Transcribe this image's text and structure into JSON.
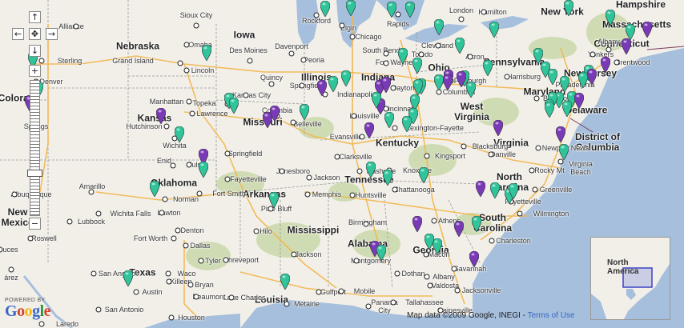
{
  "controls": {
    "pan_up": "↑",
    "pan_left": "←",
    "pan_center": "✥",
    "pan_right": "→",
    "pan_down": "↓",
    "zoom_in": "+",
    "zoom_out": "−"
  },
  "state_labels": [
    {
      "id": "nebraska",
      "text": "Nebraska"
    },
    {
      "id": "iowa",
      "text": "Iowa"
    },
    {
      "id": "illinois",
      "text": "Illinois"
    },
    {
      "id": "indiana",
      "text": "Indiana"
    },
    {
      "id": "ohio",
      "text": "Ohio"
    },
    {
      "id": "pennsylvania",
      "text": "Pennsylvania"
    },
    {
      "id": "new-york",
      "text": "New York"
    },
    {
      "id": "massachusetts",
      "text": "Massachusetts"
    },
    {
      "id": "connecticut",
      "text": "Connecticut"
    },
    {
      "id": "new-jersey",
      "text": "New Jersey"
    },
    {
      "id": "maryland",
      "text": "Maryland"
    },
    {
      "id": "delaware",
      "text": "Delaware"
    },
    {
      "id": "district-of-columbia",
      "text": "District of\nColumbia"
    },
    {
      "id": "colorado",
      "text": "Colorado"
    },
    {
      "id": "kansas",
      "text": "Kansas"
    },
    {
      "id": "missouri",
      "text": "Missouri"
    },
    {
      "id": "kentucky",
      "text": "Kentucky"
    },
    {
      "id": "west-virginia",
      "text": "West\nVirginia"
    },
    {
      "id": "virginia",
      "text": "Virginia"
    },
    {
      "id": "oklahoma",
      "text": "Oklahoma"
    },
    {
      "id": "arkansas",
      "text": "Arkansas"
    },
    {
      "id": "tennessee",
      "text": "Tennessee"
    },
    {
      "id": "north-carolina",
      "text": "North\nCarolina"
    },
    {
      "id": "south-carolina",
      "text": "South\nCarolina"
    },
    {
      "id": "new-mexico",
      "text": "New\nMexico"
    },
    {
      "id": "texas",
      "text": "Texas"
    },
    {
      "id": "mississippi",
      "text": "Mississippi"
    },
    {
      "id": "alabama",
      "text": "Alabama"
    },
    {
      "id": "georgia",
      "text": "Georgia"
    },
    {
      "id": "louisiana",
      "text": "Louisia"
    },
    {
      "id": "hampshire",
      "text": "Hampshire"
    }
  ],
  "city_labels": [
    {
      "id": "sioux-city",
      "text": "Sioux City"
    },
    {
      "id": "rockford",
      "text": "Rockford"
    },
    {
      "id": "grand-rapids",
      "text": "Rapids"
    },
    {
      "id": "london",
      "text": "London"
    },
    {
      "id": "hamilton",
      "text": "Hamilton"
    },
    {
      "id": "alliance",
      "text": "Alliance"
    },
    {
      "id": "omaha",
      "text": "Omaha"
    },
    {
      "id": "elgin",
      "text": "Elgin"
    },
    {
      "id": "chicago",
      "text": "Chicago"
    },
    {
      "id": "cleveland",
      "text": "Cleveland"
    },
    {
      "id": "albany",
      "text": "Albany"
    },
    {
      "id": "sterling",
      "text": "Sterling"
    },
    {
      "id": "grand-island",
      "text": "Grand Island"
    },
    {
      "id": "des-moines",
      "text": "Des Moines"
    },
    {
      "id": "davenport",
      "text": "Davenport"
    },
    {
      "id": "south-bend",
      "text": "South Bend"
    },
    {
      "id": "toledo",
      "text": "Toledo"
    },
    {
      "id": "akron",
      "text": "Akron"
    },
    {
      "id": "yonkers",
      "text": "Yonkers"
    },
    {
      "id": "brentwood",
      "text": "Brentwood"
    },
    {
      "id": "denver",
      "text": "Denver"
    },
    {
      "id": "lincoln",
      "text": "Lincoln"
    },
    {
      "id": "peoria",
      "text": "Peoria"
    },
    {
      "id": "fort-wayne",
      "text": "Fort Wayne"
    },
    {
      "id": "harrisburg",
      "text": "Harrisburg"
    },
    {
      "id": "quincy",
      "text": "Quincy"
    },
    {
      "id": "pittsburgh",
      "text": "Pittsburgh"
    },
    {
      "id": "dayton",
      "text": "Dayton"
    },
    {
      "id": "springfield-il",
      "text": "Springfield"
    },
    {
      "id": "columbus",
      "text": "Columbus"
    },
    {
      "id": "indianapolis",
      "text": "Indianapolis"
    },
    {
      "id": "philadelphia",
      "text": "Philadelphia"
    },
    {
      "id": "manhattan",
      "text": "Manhattan"
    },
    {
      "id": "kansas-city",
      "text": "Kansas City"
    },
    {
      "id": "topeka",
      "text": "Topeka"
    },
    {
      "id": "lawrence",
      "text": "Lawrence"
    },
    {
      "id": "baltimore",
      "text": "Baltimore"
    },
    {
      "id": "cincinnati",
      "text": "Cincinnati"
    },
    {
      "id": "colorado-springs",
      "text": "Springs"
    },
    {
      "id": "columbia-mo",
      "text": "Columbia"
    },
    {
      "id": "louisville",
      "text": "Louisville"
    },
    {
      "id": "belleville",
      "text": "Belleville"
    },
    {
      "id": "hutchinson",
      "text": "Hutchinson"
    },
    {
      "id": "lexington",
      "text": "Lexington-Fayette"
    },
    {
      "id": "evansville",
      "text": "Evansville"
    },
    {
      "id": "wichita",
      "text": "Wichita"
    },
    {
      "id": "springfield-mo",
      "text": "Springfield"
    },
    {
      "id": "danville",
      "text": "Danville"
    },
    {
      "id": "newport-news",
      "text": "Newport News"
    },
    {
      "id": "kingsport",
      "text": "Kingsport"
    },
    {
      "id": "blacksburg",
      "text": "Blacksburg"
    },
    {
      "id": "clarksville",
      "text": "Clarksville"
    },
    {
      "id": "enid",
      "text": "Enid"
    },
    {
      "id": "tulsa",
      "text": "Tulsa"
    },
    {
      "id": "fayetteville-ar",
      "text": "Fayetteville"
    },
    {
      "id": "jonesboro",
      "text": "Jonesboro"
    },
    {
      "id": "knoxville",
      "text": "Knoxville"
    },
    {
      "id": "virginia-beach",
      "text": "Virginia\nBeach"
    },
    {
      "id": "nashville",
      "text": "Nashville"
    },
    {
      "id": "jackson-tn",
      "text": "Jackson"
    },
    {
      "id": "rocky-mount",
      "text": "Rocky Mt"
    },
    {
      "id": "amarillo",
      "text": "Amarillo"
    },
    {
      "id": "fort-smith",
      "text": "Fort Smith"
    },
    {
      "id": "memphis",
      "text": "Memphis"
    },
    {
      "id": "huntsville",
      "text": "Huntsville"
    },
    {
      "id": "chattanooga",
      "text": "Chattanooga"
    },
    {
      "id": "greenville",
      "text": "Greenville"
    },
    {
      "id": "albuquerque",
      "text": "Albuquerque"
    },
    {
      "id": "norman",
      "text": "Norman"
    },
    {
      "id": "fayetteville-nc",
      "text": "Fayetteville"
    },
    {
      "id": "lawton",
      "text": "Lawton"
    },
    {
      "id": "wichita-falls",
      "text": "Wichita Falls"
    },
    {
      "id": "pine-bluff",
      "text": "Pine Bluff"
    },
    {
      "id": "wilmington",
      "text": "Wilmington"
    },
    {
      "id": "lubbock",
      "text": "Lubbock"
    },
    {
      "id": "birmingham",
      "text": "Birmingham"
    },
    {
      "id": "athens",
      "text": "Athens"
    },
    {
      "id": "hilo",
      "text": "Hilo"
    },
    {
      "id": "charleston",
      "text": "Charleston"
    },
    {
      "id": "roswell",
      "text": "Roswell"
    },
    {
      "id": "fort-worth",
      "text": "Fort Worth"
    },
    {
      "id": "denton",
      "text": "Denton"
    },
    {
      "id": "dallas",
      "text": "Dallas"
    },
    {
      "id": "tyler",
      "text": "Tyler"
    },
    {
      "id": "shreveport",
      "text": "Shreveport"
    },
    {
      "id": "jackson-ms",
      "text": "Jackson"
    },
    {
      "id": "montgomery",
      "text": "Montgomery"
    },
    {
      "id": "macon",
      "text": "Macon"
    },
    {
      "id": "savannah",
      "text": "Savannah"
    },
    {
      "id": "ruces",
      "text": "uces"
    },
    {
      "id": "san-angelo",
      "text": "San Angelo"
    },
    {
      "id": "waco",
      "text": "Waco"
    },
    {
      "id": "dothan",
      "text": "Dothan"
    },
    {
      "id": "juarez",
      "text": "árez"
    },
    {
      "id": "killeen",
      "text": "Killeen"
    },
    {
      "id": "bryan",
      "text": "Bryan"
    },
    {
      "id": "albany-ga",
      "text": "Albany"
    },
    {
      "id": "austin",
      "text": "Austin"
    },
    {
      "id": "gulfport",
      "text": "Gulfport"
    },
    {
      "id": "mobile",
      "text": "Mobile"
    },
    {
      "id": "valdosta",
      "text": "Valdosta"
    },
    {
      "id": "jacksonville",
      "text": "Jacksonville"
    },
    {
      "id": "lake-charles",
      "text": "Lake Charles"
    },
    {
      "id": "beaumont",
      "text": "Beaumont"
    },
    {
      "id": "panama-city",
      "text": "Panama\nCity"
    },
    {
      "id": "tallahassee",
      "text": "Tallahassee"
    },
    {
      "id": "gainesville",
      "text": "Gainesville"
    },
    {
      "id": "san-antonio",
      "text": "San Antonio"
    },
    {
      "id": "metairie",
      "text": "Metairie"
    },
    {
      "id": "houston",
      "text": "Houston"
    },
    {
      "id": "laredo",
      "text": "Laredo"
    }
  ],
  "overview": {
    "region_label": "North\nAmerica"
  },
  "branding": {
    "powered_by": "POWERED BY",
    "logo_letters": [
      "G",
      "o",
      "o",
      "g",
      "l",
      "e"
    ],
    "logo_colors": [
      "#3a66c4",
      "#d8402a",
      "#f2b90c",
      "#3a66c4",
      "#2e9a3a",
      "#d8402a"
    ]
  },
  "attribution": {
    "text": "Map data ©2009 Google, INEGI - ",
    "terms_link": "Terms of Use"
  },
  "marker_colors": {
    "teal": "#2fc49a",
    "purple": "#7a3ab8"
  },
  "markers": [
    {
      "color": "teal"
    },
    {
      "color": "teal"
    },
    {
      "color": "teal"
    },
    {
      "color": "teal"
    },
    {
      "color": "teal"
    },
    {
      "color": "teal"
    },
    {
      "color": "teal"
    },
    {
      "color": "purple"
    },
    {
      "color": "teal"
    },
    {
      "color": "purple"
    },
    {
      "color": "teal"
    },
    {
      "color": "teal"
    },
    {
      "color": "teal"
    },
    {
      "color": "teal"
    },
    {
      "color": "teal"
    },
    {
      "color": "teal"
    },
    {
      "color": "teal"
    },
    {
      "color": "purple"
    },
    {
      "color": "teal"
    },
    {
      "color": "teal"
    },
    {
      "color": "teal"
    },
    {
      "color": "teal"
    },
    {
      "color": "teal"
    },
    {
      "color": "purple"
    },
    {
      "color": "purple"
    },
    {
      "color": "teal"
    },
    {
      "color": "teal"
    },
    {
      "color": "purple"
    },
    {
      "color": "purple"
    },
    {
      "color": "teal"
    },
    {
      "color": "purple"
    },
    {
      "color": "teal"
    },
    {
      "color": "purple"
    },
    {
      "color": "teal"
    },
    {
      "color": "teal"
    },
    {
      "color": "teal"
    },
    {
      "color": "teal"
    },
    {
      "color": "teal"
    },
    {
      "color": "teal"
    },
    {
      "color": "teal"
    },
    {
      "color": "teal"
    },
    {
      "color": "purple"
    },
    {
      "color": "teal"
    },
    {
      "color": "teal"
    },
    {
      "color": "purple"
    },
    {
      "color": "purple"
    },
    {
      "color": "teal"
    },
    {
      "color": "teal"
    },
    {
      "color": "teal"
    },
    {
      "color": "teal"
    },
    {
      "color": "teal"
    },
    {
      "color": "purple"
    },
    {
      "color": "teal"
    },
    {
      "color": "purple"
    },
    {
      "color": "purple"
    },
    {
      "color": "purple"
    },
    {
      "color": "teal"
    },
    {
      "color": "teal"
    },
    {
      "color": "teal"
    },
    {
      "color": "purple"
    },
    {
      "color": "purple"
    },
    {
      "color": "purple"
    },
    {
      "color": "teal"
    },
    {
      "color": "teal"
    },
    {
      "color": "purple"
    },
    {
      "color": "teal"
    },
    {
      "color": "teal"
    },
    {
      "color": "teal"
    },
    {
      "color": "teal"
    },
    {
      "color": "teal"
    },
    {
      "color": "teal"
    },
    {
      "color": "purple"
    },
    {
      "color": "teal"
    },
    {
      "color": "teal"
    },
    {
      "color": "teal"
    },
    {
      "color": "teal"
    },
    {
      "color": "purple"
    },
    {
      "color": "purple"
    },
    {
      "color": "teal"
    },
    {
      "color": "purple"
    },
    {
      "color": "teal"
    },
    {
      "color": "teal"
    },
    {
      "color": "purple"
    },
    {
      "color": "teal"
    },
    {
      "color": "teal"
    }
  ]
}
